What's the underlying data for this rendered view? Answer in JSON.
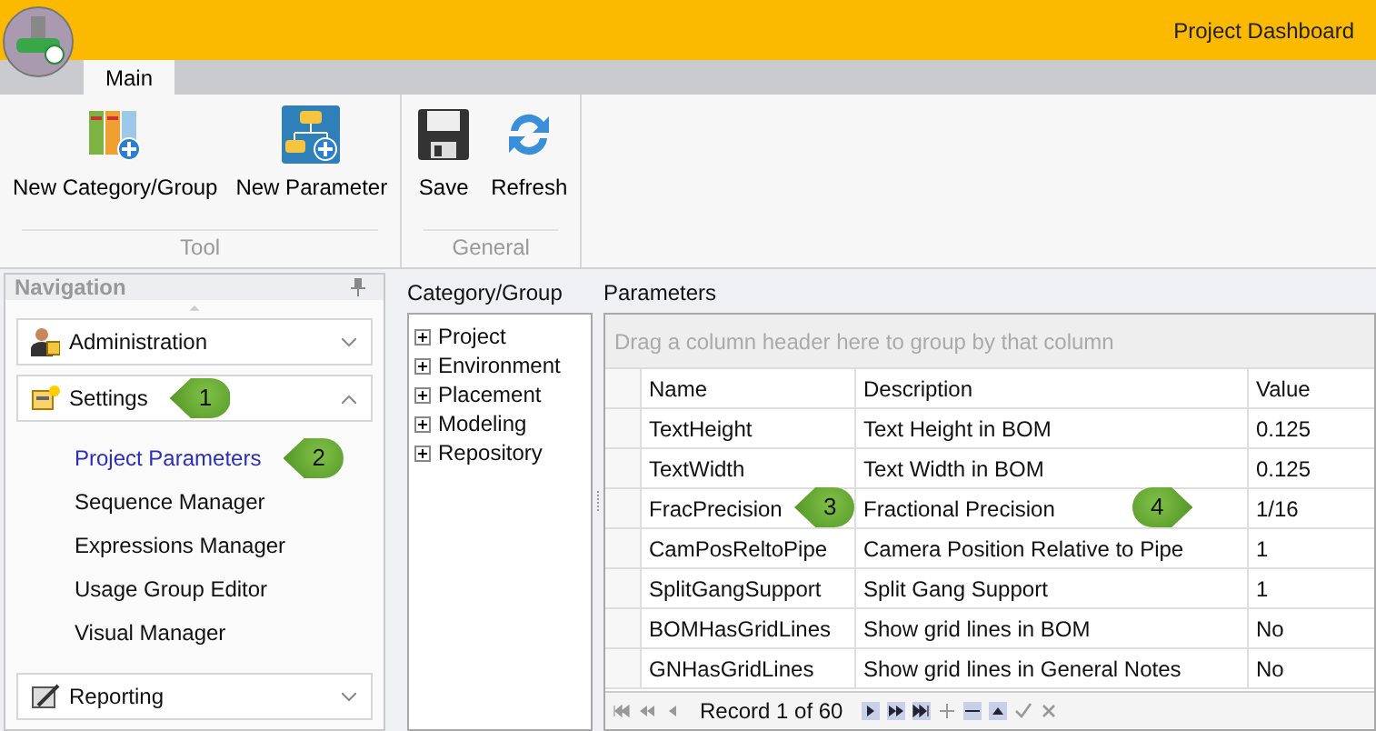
{
  "window": {
    "title": "Project Dashboard"
  },
  "ribbon": {
    "tabs": [
      {
        "label": "Main",
        "selected": true
      }
    ],
    "groups": [
      {
        "label": "Tool",
        "buttons": [
          {
            "kind": "category",
            "label": "New Category/Group"
          },
          {
            "kind": "parameter",
            "label": "New Parameter"
          }
        ]
      },
      {
        "label": "General",
        "buttons": [
          {
            "kind": "save",
            "label": "Save"
          },
          {
            "kind": "refresh",
            "label": "Refresh"
          }
        ]
      }
    ]
  },
  "navigation": {
    "title": "Navigation",
    "groups": [
      {
        "kind": "admin",
        "label": "Administration",
        "expanded": false
      },
      {
        "kind": "settings",
        "label": "Settings",
        "expanded": true,
        "callout": "1",
        "items": [
          {
            "label": "Project Parameters",
            "selected": true,
            "callout": "2"
          },
          {
            "label": "Sequence Manager",
            "selected": false
          },
          {
            "label": "Expressions Manager",
            "selected": false
          },
          {
            "label": "Usage Group Editor",
            "selected": false
          },
          {
            "label": "Visual Manager",
            "selected": false
          }
        ]
      },
      {
        "kind": "reporting",
        "label": "Reporting",
        "expanded": false
      }
    ]
  },
  "category_tree": {
    "title": "Category/Group",
    "nodes": [
      {
        "label": "Project",
        "expanded": false
      },
      {
        "label": "Environment",
        "expanded": false
      },
      {
        "label": "Placement",
        "expanded": false
      },
      {
        "label": "Modeling",
        "expanded": false
      },
      {
        "label": "Repository",
        "expanded": false
      }
    ]
  },
  "parameters": {
    "title": "Parameters",
    "group_panel": "Drag a column header here to group by that column",
    "columns": [
      "Name",
      "Description",
      "Value"
    ],
    "rows": [
      {
        "name": "TextHeight",
        "description": "Text Height in BOM",
        "value": "0.125"
      },
      {
        "name": "TextWidth",
        "description": "Text Width in BOM",
        "value": "0.125"
      },
      {
        "name": "FracPrecision",
        "description": "Fractional Precision",
        "value": "1/16",
        "name_callout": "3",
        "value_callout": "4"
      },
      {
        "name": "CamPosReltoPipe",
        "description": "Camera Position Relative to Pipe",
        "value": "1"
      },
      {
        "name": "SplitGangSupport",
        "description": "Split Gang Support",
        "value": "1"
      },
      {
        "name": "BOMHasGridLines",
        "description": "Show grid lines in BOM",
        "value": "No"
      },
      {
        "name": "GNHasGridLines",
        "description": "Show grid lines in General Notes",
        "value": "No"
      }
    ],
    "navigator": "Record 1 of 60"
  }
}
